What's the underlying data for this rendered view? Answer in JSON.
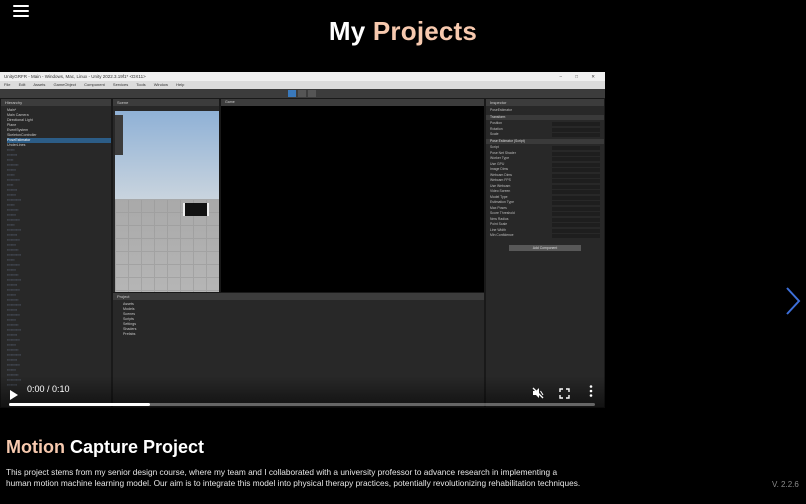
{
  "header": {
    "title_plain": "My",
    "title_accent": "Projects",
    "menu_icon": "hamburger-menu-icon"
  },
  "carousel": {
    "prev_icon": "chevron-left-icon",
    "next_icon": "chevron-right-icon",
    "arrow_color": "#3d6fd9"
  },
  "video": {
    "window_title": "UnityGRFR - Main - Windows, Mac, Linux - Unity 2022.3.19f1* <DX11>",
    "menu": [
      "File",
      "Edit",
      "Assets",
      "GameObject",
      "Component",
      "Services",
      "Tools",
      "Window",
      "Help"
    ],
    "panels": {
      "hierarchy": "Hierarchy",
      "scene": "Scene",
      "game": "Game",
      "project": "Project",
      "inspector": "Inspector"
    },
    "hierarchy_items": [
      "Main*",
      "Main Camera",
      "Directional Light",
      "Plane",
      "EventSystem",
      "SkeletonController",
      "PoseEstimator",
      "UnderLines"
    ],
    "project_items": [
      "Assets",
      "Models",
      "Scenes",
      "Scripts",
      "Settings",
      "Shaders",
      "Prefabs"
    ],
    "inspector": {
      "object_name": "PoseEstimator",
      "sections": [
        "Transform",
        "Pose Estimator (Script)"
      ],
      "fields": [
        "Position",
        "Rotation",
        "Scale",
        "Script",
        "Pose Net Shader",
        "Worker Type",
        "Use GPU",
        "Image Dims",
        "Webcam Dims",
        "Webcam FPS",
        "Use Webcam",
        "Video Screen",
        "Model Type",
        "Estimation Type",
        "Max Poses",
        "Score Threshold",
        "Nms Radius",
        "Point Scale",
        "Line Width",
        "Min Confidence"
      ],
      "add_component": "Add Component"
    },
    "controls": {
      "time": "0:00 / 0:10",
      "progress": 0.24,
      "play_icon": "play-icon",
      "mute_icon": "muted-speaker-icon",
      "fullscreen_icon": "fullscreen-icon",
      "more_icon": "more-vertical-icon"
    }
  },
  "project": {
    "title_accent": "Motion",
    "title_plain": "Capture Project",
    "description": "This project stems from my senior design course, where my team and I collaborated with a university professor to advance research in implementing a human motion machine learning model. Our aim is to integrate this model into physical therapy practices, potentially revolutionizing rehabilitation techniques."
  },
  "footer": {
    "version": "V. 2.2.6"
  },
  "colors": {
    "background": "#000000",
    "accent": "#f7c9ae",
    "text": "#ffffff"
  }
}
